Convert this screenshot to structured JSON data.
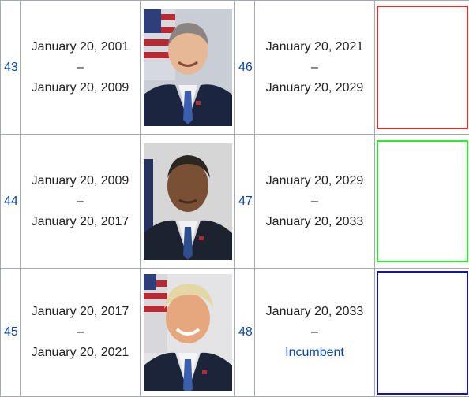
{
  "rows": [
    {
      "left_number": "43",
      "left_term_start": "January 20, 2001",
      "left_term_sep": "–",
      "left_term_end": "January 20, 2009",
      "portrait_icon": "portrait-photo-icon",
      "right_number": "46",
      "right_term_start": "January 20, 2021",
      "right_term_sep": "–",
      "right_term_end": "January 20, 2029",
      "box_color": "#d9312f"
    },
    {
      "left_number": "44",
      "left_term_start": "January 20, 2009",
      "left_term_sep": "–",
      "left_term_end": "January 20, 2017",
      "portrait_icon": "portrait-photo-icon",
      "right_number": "47",
      "right_term_start": "January 20, 2029",
      "right_term_sep": "–",
      "right_term_end": "January 20, 2033",
      "box_color": "#2ee82e"
    },
    {
      "left_number": "45",
      "left_term_start": "January 20, 2017",
      "left_term_sep": "–",
      "left_term_end": "January 20, 2021",
      "portrait_icon": "portrait-photo-icon",
      "right_number": "48",
      "right_term_start": "January 20, 2033",
      "right_term_sep": "–",
      "right_term_end": "Incumbent",
      "box_color": "#1414b4"
    }
  ],
  "colors": {
    "link": "#0645ad",
    "text": "#202122",
    "border": "#a2a9b1"
  }
}
